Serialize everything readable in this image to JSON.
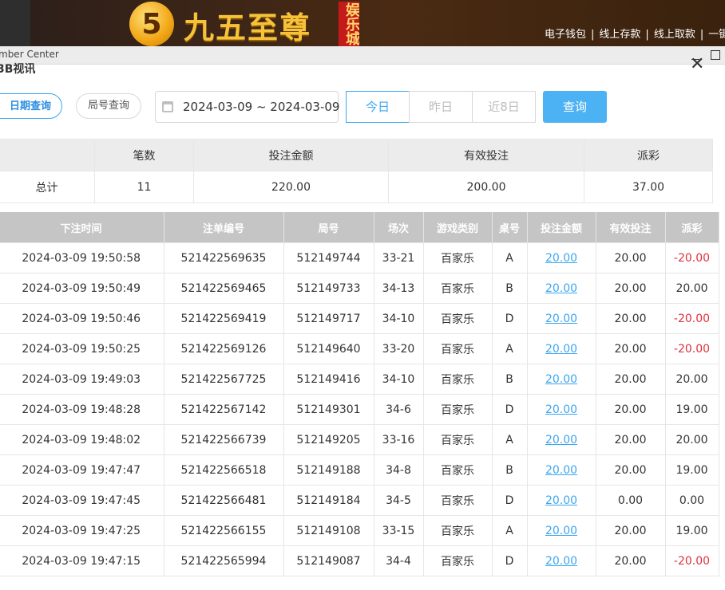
{
  "header": {
    "logo_digit": "5",
    "logo_text": "九五至尊",
    "logo_badge": "娱乐城",
    "nav": [
      "电子钱包",
      "线上存款",
      "线上取款",
      "一键"
    ]
  },
  "window": {
    "title": "mber Center"
  },
  "dialog": {
    "title": "3B视讯"
  },
  "filters": {
    "date_query": "日期查询",
    "round_query": "局号查询",
    "date_range": "2024-03-09 ~ 2024-03-09",
    "today": "今日",
    "yesterday": "昨日",
    "last8": "近8日",
    "submit": "查询"
  },
  "summary": {
    "headers": [
      "",
      "笔数",
      "投注金额",
      "有效投注",
      "派彩"
    ],
    "row": [
      "总计",
      "11",
      "220.00",
      "200.00",
      "37.00"
    ]
  },
  "table": {
    "headers": [
      "下注时间",
      "注单编号",
      "局号",
      "场次",
      "游戏类别",
      "桌号",
      "投注金额",
      "有效投注",
      "派彩"
    ],
    "rows": [
      [
        "2024-03-09 19:50:58",
        "521422569635",
        "512149744",
        "33-21",
        "百家乐",
        "A",
        "20.00",
        "20.00",
        "-20.00"
      ],
      [
        "2024-03-09 19:50:49",
        "521422569465",
        "512149733",
        "34-13",
        "百家乐",
        "B",
        "20.00",
        "20.00",
        "20.00"
      ],
      [
        "2024-03-09 19:50:46",
        "521422569419",
        "512149717",
        "34-10",
        "百家乐",
        "D",
        "20.00",
        "20.00",
        "-20.00"
      ],
      [
        "2024-03-09 19:50:25",
        "521422569126",
        "512149640",
        "33-20",
        "百家乐",
        "A",
        "20.00",
        "20.00",
        "-20.00"
      ],
      [
        "2024-03-09 19:49:03",
        "521422567725",
        "512149416",
        "34-10",
        "百家乐",
        "B",
        "20.00",
        "20.00",
        "20.00"
      ],
      [
        "2024-03-09 19:48:28",
        "521422567142",
        "512149301",
        "34-6",
        "百家乐",
        "D",
        "20.00",
        "20.00",
        "19.00"
      ],
      [
        "2024-03-09 19:48:02",
        "521422566739",
        "512149205",
        "33-16",
        "百家乐",
        "A",
        "20.00",
        "20.00",
        "20.00"
      ],
      [
        "2024-03-09 19:47:47",
        "521422566518",
        "512149188",
        "34-8",
        "百家乐",
        "B",
        "20.00",
        "20.00",
        "19.00"
      ],
      [
        "2024-03-09 19:47:45",
        "521422566481",
        "512149184",
        "34-5",
        "百家乐",
        "D",
        "20.00",
        "0.00",
        "0.00"
      ],
      [
        "2024-03-09 19:47:25",
        "521422566155",
        "512149108",
        "33-15",
        "百家乐",
        "A",
        "20.00",
        "20.00",
        "19.00"
      ],
      [
        "2024-03-09 19:47:15",
        "521422565994",
        "512149087",
        "34-4",
        "百家乐",
        "D",
        "20.00",
        "20.00",
        "-20.00"
      ]
    ]
  },
  "colors": {
    "accent": "#3aa6f0",
    "negative": "#e0303a",
    "header_bg": "#c5c5c5"
  }
}
